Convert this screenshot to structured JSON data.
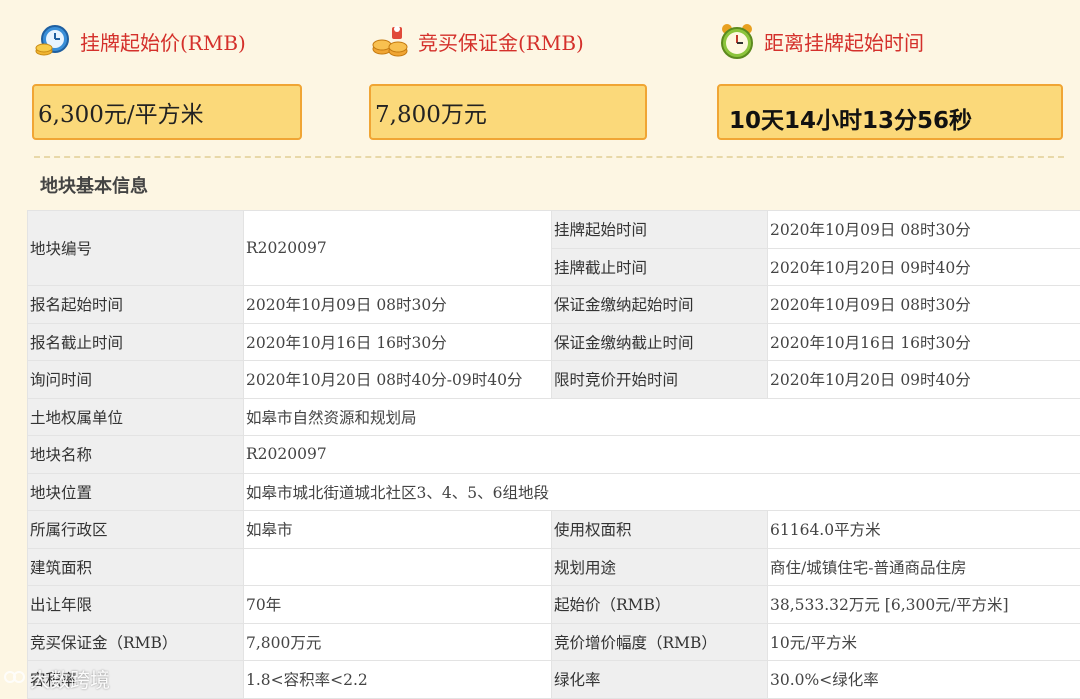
{
  "header": {
    "start_price": {
      "icon": "clock-coin-icon",
      "label": "挂牌起始价(RMB)",
      "value": "6,300元/平方米"
    },
    "deposit": {
      "icon": "coins-icon",
      "label": "竞买保证金(RMB)",
      "value": "7,800万元"
    },
    "countdown": {
      "icon": "alarm-clock-icon",
      "label": "距离挂牌起始时间",
      "value": "10天14小时13分56秒"
    }
  },
  "section_title": "地块基本信息",
  "table": {
    "r1": {
      "l1": "地块编号",
      "v1": "R2020097",
      "l2": "挂牌起始时间",
      "v2": "2020年10月09日 08时30分"
    },
    "r2": {
      "l2": "挂牌截止时间",
      "v2": "2020年10月20日 09时40分"
    },
    "r3": {
      "l1": "报名起始时间",
      "v1": "2020年10月09日 08时30分",
      "l2": "保证金缴纳起始时间",
      "v2": "2020年10月09日 08时30分"
    },
    "r4": {
      "l1": "报名截止时间",
      "v1": "2020年10月16日 16时30分",
      "l2": "保证金缴纳截止时间",
      "v2": "2020年10月16日 16时30分"
    },
    "r5": {
      "l1": "询问时间",
      "v1": "2020年10月20日 08时40分-09时40分",
      "l2": "限时竞价开始时间",
      "v2": "2020年10月20日 09时40分"
    },
    "r6": {
      "l1": "土地权属单位",
      "v1": "如皋市自然资源和规划局"
    },
    "r7": {
      "l1": "地块名称",
      "v1": "R2020097"
    },
    "r8": {
      "l1": "地块位置",
      "v1": "如皋市城北街道城北社区3、4、5、6组地段"
    },
    "r9": {
      "l1": "所属行政区",
      "v1": "如皋市",
      "l2": "使用权面积",
      "v2": "61164.0平方米"
    },
    "r10": {
      "l1": "建筑面积",
      "v1": "",
      "l2": "规划用途",
      "v2": "商住/城镇住宅-普通商品住房"
    },
    "r11": {
      "l1": "出让年限",
      "v1": "70年",
      "l2": "起始价（RMB）",
      "v2": "38,533.32万元 [6,300元/平方米]"
    },
    "r12": {
      "l1": "竞买保证金（RMB）",
      "v1": "7,800万元",
      "l2": "竞价增价幅度（RMB）",
      "v2": "10元/平方米"
    },
    "r13": {
      "l1": "容积率",
      "v1": "1.8<容积率<2.2",
      "l2": "绿化率",
      "v2": "30.0%<绿化率"
    }
  },
  "watermark": "大数跨境"
}
